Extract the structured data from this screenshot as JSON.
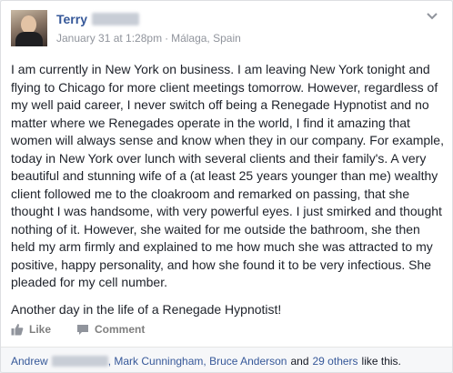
{
  "post": {
    "author_name": "Terry",
    "date": "January 31 at 1:28pm",
    "separator": "·",
    "location": "Málaga, Spain",
    "paragraphs": [
      "I am currently in New York on business. I am leaving New York tonight and flying to Chicago for more client meetings tomorrow. However, regardless of my well paid career, I never switch off being a Renegade Hypnotist and no matter where we Renegades operate in the world, I find it amazing that women will always sense and know when they in our company. For example, today in New York over lunch with several clients and their family's. A very beautiful and stunning wife of a (at least 25 years younger than me) wealthy client followed me to the cloakroom and remarked on passing, that she thought I was handsome, with very powerful eyes. I just smirked and thought nothing of it. However, she waited for me outside the bathroom, she then held my arm firmly and explained to me how much she was attracted to my positive, happy personality, and how she found it to be very infectious. She pleaded for my cell number.",
      "Another day in the life of a Renegade Hypnotist!"
    ]
  },
  "actions": {
    "like_label": "Like",
    "comment_label": "Comment"
  },
  "likes": {
    "first_name": "Andrew",
    "names_rest": ", Mark Cunningham, Bruce Anderson",
    "and_text": "and",
    "others_label": "29 others",
    "suffix": "like this."
  },
  "colors": {
    "link": "#365899",
    "meta": "#90949c",
    "text": "#1d2129"
  }
}
